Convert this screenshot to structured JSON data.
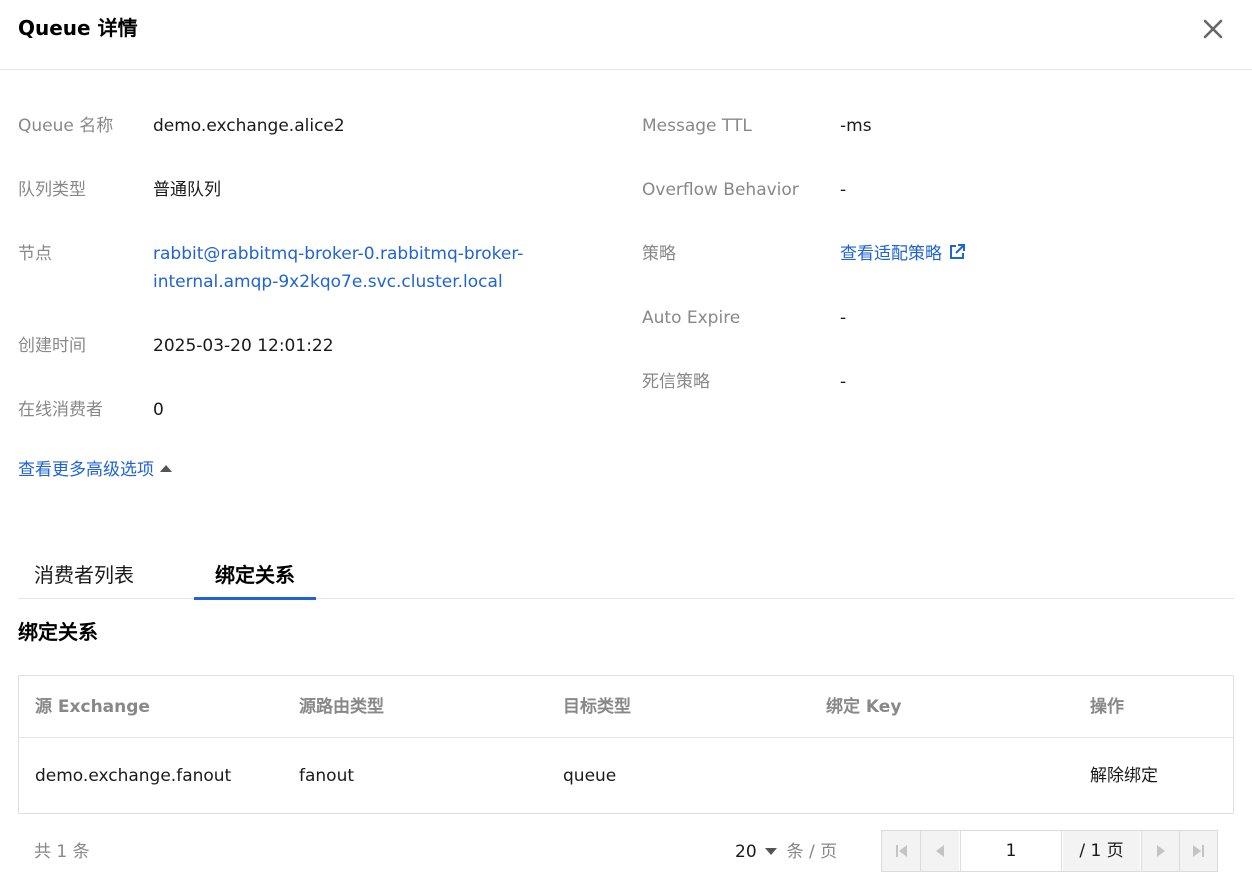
{
  "header": {
    "title": "Queue 详情"
  },
  "details_left": [
    {
      "label": "Queue 名称",
      "value": "demo.exchange.alice2"
    },
    {
      "label": "队列类型",
      "value": "普通队列"
    },
    {
      "label": "节点",
      "value": "rabbit@rabbitmq-broker-0.rabbitmq-broker-internal.amqp-9x2kqo7e.svc.cluster.local"
    },
    {
      "label": "创建时间",
      "value": "2025-03-20 12:01:22"
    },
    {
      "label": "在线消费者",
      "value": "0"
    }
  ],
  "details_right": [
    {
      "label": "Message TTL",
      "value": "-ms"
    },
    {
      "label": "Overflow Behavior",
      "value": "-"
    },
    {
      "label": "策略",
      "value": "查看适配策略"
    },
    {
      "label": "Auto Expire",
      "value": "-"
    },
    {
      "label": "死信策略",
      "value": "-"
    }
  ],
  "more_options": "查看更多高级选项",
  "tabs": [
    {
      "label": "消费者列表"
    },
    {
      "label": "绑定关系"
    }
  ],
  "section_title": "绑定关系",
  "table": {
    "columns": [
      "源 Exchange",
      "源路由类型",
      "目标类型",
      "绑定 Key",
      "操作"
    ],
    "rows": [
      {
        "source_exchange": "demo.exchange.fanout",
        "routing_type": "fanout",
        "target_type": "queue",
        "binding_key": "",
        "action": "解除绑定"
      }
    ]
  },
  "pagination": {
    "total": "共 1 条",
    "page_size": "20",
    "page_size_unit": "条 / 页",
    "current_page": "1",
    "total_pages": "/ 1 页"
  },
  "colors": {
    "link": "#1f63d6",
    "label": "#888888",
    "text": "#1a1a1a"
  }
}
